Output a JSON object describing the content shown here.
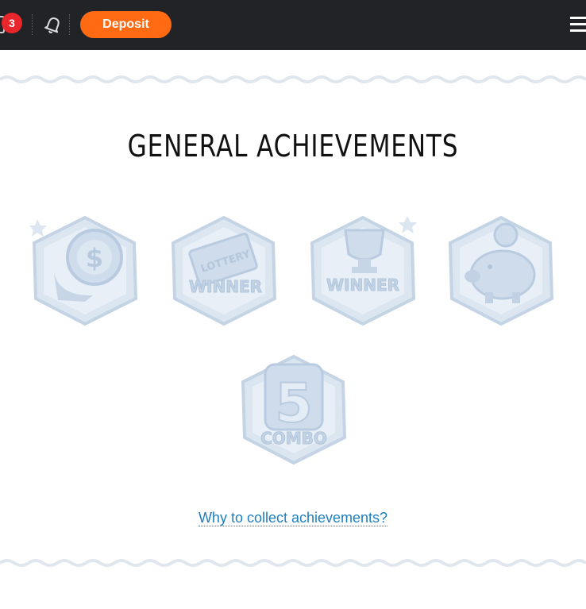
{
  "header": {
    "notification_count": "3",
    "deposit_label": "Deposit"
  },
  "page": {
    "title": "GENERAL ACHIEVEMENTS"
  },
  "achievements": [
    {
      "name": "coin-achievement",
      "icon": "coin-dollar-icon",
      "status": "locked"
    },
    {
      "name": "lottery-winner-achievement",
      "icon": "lottery-ticket-icon",
      "label_text": "LOTTERY WINNER",
      "status": "locked"
    },
    {
      "name": "trophy-winner-achievement",
      "icon": "trophy-icon",
      "label_text": "WINNER",
      "status": "locked"
    },
    {
      "name": "piggy-bank-achievement",
      "icon": "piggy-bank-icon",
      "status": "locked"
    },
    {
      "name": "combo-achievement",
      "icon": "combo-5-icon",
      "label_text": "5 COMBO",
      "status": "locked"
    }
  ],
  "footer": {
    "why_link": "Why to collect achievements?"
  },
  "colors": {
    "topbar": "#222326",
    "deposit_button": "#ff6a13",
    "notification_badge": "#e8262c",
    "link": "#1e7fbf",
    "locked_badge": "#d6e2ef"
  }
}
